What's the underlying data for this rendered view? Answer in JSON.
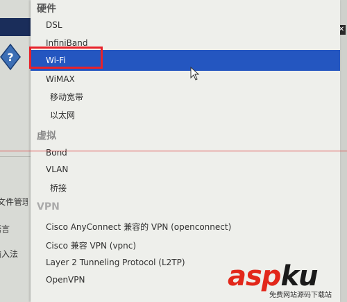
{
  "background_window": {
    "labels": [
      "文件管理",
      "语言",
      "输入法"
    ]
  },
  "menu": {
    "sections": [
      {
        "header": "硬件",
        "items": [
          "DSL",
          "InfiniBand",
          "Wi-Fi",
          "WiMAX",
          "移动宽带",
          "以太网"
        ]
      },
      {
        "header": "虚拟",
        "items": [
          "Bond",
          "VLAN",
          "桥接"
        ]
      },
      {
        "header": "VPN",
        "items": [
          "Cisco AnyConnect 兼容的 VPN (openconnect)",
          "Cisco 兼容 VPN (vpnc)",
          "Layer 2 Tunneling Protocol (L2TP)",
          "OpenVPN"
        ]
      }
    ],
    "selected_item": "Wi-Fi"
  },
  "colors": {
    "selection": "#2456c0",
    "highlight_box": "#e8222a"
  },
  "watermark": {
    "brand_red": "asp",
    "brand_black": "ku",
    "subtitle": "免费网站源码下载站"
  }
}
